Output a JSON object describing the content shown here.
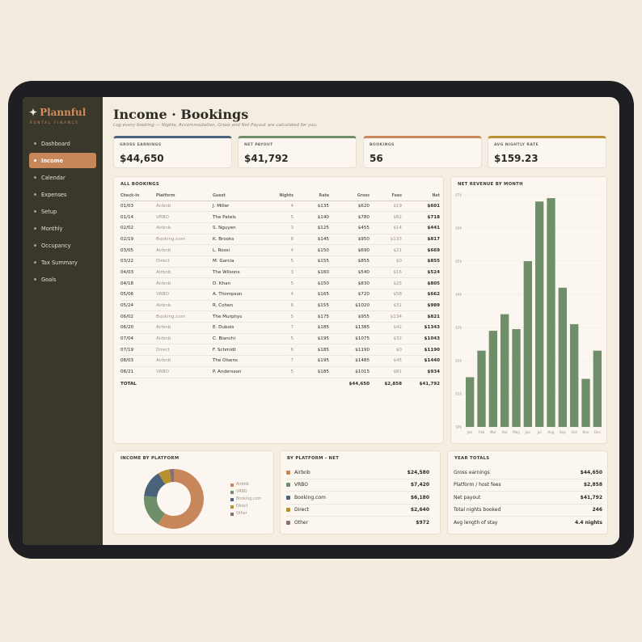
{
  "brand": {
    "name": "Plannful",
    "subtitle": "RENTAL FINANCE"
  },
  "nav": [
    {
      "label": "Dashboard",
      "active": false
    },
    {
      "label": "Income",
      "active": true
    },
    {
      "label": "Calendar",
      "active": false
    },
    {
      "label": "Expenses",
      "active": false
    },
    {
      "label": "Setup",
      "active": false
    },
    {
      "label": "Monthly",
      "active": false
    },
    {
      "label": "Occupancy",
      "active": false
    },
    {
      "label": "Tax Summary",
      "active": false
    },
    {
      "label": "Goals",
      "active": false
    }
  ],
  "page": {
    "title": "Income · Bookings",
    "subtitle": "Log every booking — Nights, Accommodation, Gross and Net Payout are calculated for you."
  },
  "kpis": [
    {
      "label": "GROSS EARNINGS",
      "value": "$44,650",
      "color": "#4a637a"
    },
    {
      "label": "NET PAYOUT",
      "value": "$41,792",
      "color": "#6f8f6a"
    },
    {
      "label": "BOOKINGS",
      "value": "56",
      "color": "#c8875a"
    },
    {
      "label": "AVG NIGHTLY RATE",
      "value": "$159.23",
      "color": "#b8902f"
    }
  ],
  "bookings": {
    "title": "ALL BOOKINGS",
    "columns": [
      "Check-in",
      "Platform",
      "Guest",
      "Nights",
      "Rate",
      "Gross",
      "Fees",
      "Net"
    ],
    "rows": [
      [
        "01/03",
        "Airbnb",
        "J. Miller",
        "4",
        "$135",
        "$620",
        "$19",
        "$601"
      ],
      [
        "01/14",
        "VRBO",
        "The Patels",
        "5",
        "$140",
        "$780",
        "$62",
        "$718"
      ],
      [
        "02/02",
        "Airbnb",
        "S. Nguyen",
        "3",
        "$125",
        "$455",
        "$14",
        "$441"
      ],
      [
        "02/19",
        "Booking.com",
        "K. Brooks",
        "6",
        "$145",
        "$950",
        "$133",
        "$817"
      ],
      [
        "03/05",
        "Airbnb",
        "L. Rossi",
        "4",
        "$150",
        "$690",
        "$21",
        "$669"
      ],
      [
        "03/22",
        "Direct",
        "M. Garcia",
        "5",
        "$155",
        "$855",
        "$0",
        "$855"
      ],
      [
        "04/03",
        "Airbnb",
        "The Wilsons",
        "3",
        "$160",
        "$540",
        "$16",
        "$524"
      ],
      [
        "04/18",
        "Airbnb",
        "D. Khan",
        "5",
        "$150",
        "$830",
        "$25",
        "$805"
      ],
      [
        "05/06",
        "VRBO",
        "A. Thompson",
        "4",
        "$165",
        "$720",
        "$58",
        "$662"
      ],
      [
        "05/24",
        "Airbnb",
        "R. Cohen",
        "6",
        "$155",
        "$1020",
        "$31",
        "$989"
      ],
      [
        "06/02",
        "Booking.com",
        "The Murphys",
        "5",
        "$175",
        "$955",
        "$134",
        "$821"
      ],
      [
        "06/20",
        "Airbnb",
        "E. Dubois",
        "7",
        "$185",
        "$1385",
        "$42",
        "$1343"
      ],
      [
        "07/04",
        "Airbnb",
        "C. Bianchi",
        "5",
        "$195",
        "$1075",
        "$32",
        "$1043"
      ],
      [
        "07/19",
        "Direct",
        "F. Schmidt",
        "6",
        "$185",
        "$1190",
        "$0",
        "$1190"
      ],
      [
        "08/03",
        "Airbnb",
        "The Olsens",
        "7",
        "$195",
        "$1485",
        "$45",
        "$1440"
      ],
      [
        "08/21",
        "VRBO",
        "P. Andersson",
        "5",
        "$185",
        "$1015",
        "$81",
        "$934"
      ]
    ],
    "total": {
      "label": "TOTAL",
      "gross": "$44,650",
      "fees": "$2,858",
      "net": "$41,792"
    }
  },
  "chart_data": {
    "type": "bar",
    "title": "NET REVENUE BY MONTH",
    "categories": [
      "Jan",
      "Feb",
      "Mar",
      "Apr",
      "May",
      "Jun",
      "Jul",
      "Aug",
      "Sep",
      "Oct",
      "Nov",
      "Dec"
    ],
    "values": [
      1500,
      2300,
      2900,
      3400,
      2950,
      5000,
      6800,
      6900,
      4200,
      3100,
      1450,
      2300
    ],
    "ylim": [
      0,
      7000
    ],
    "yticks": [
      "$0k",
      "$1k",
      "$2k",
      "$3k",
      "$4k",
      "$5k",
      "$6k",
      "$7k"
    ],
    "color": "#6f8f6a",
    "grid": true
  },
  "platform_donut": {
    "title": "INCOME BY PLATFORM",
    "legend": [
      "Airbnb",
      "VRBO",
      "Booking.com",
      "Direct",
      "Other"
    ],
    "colors": [
      "#c8875a",
      "#6f8f6a",
      "#4a637a",
      "#b8902f",
      "#8a6f6f"
    ],
    "values": [
      24580,
      7420,
      6180,
      2640,
      972
    ]
  },
  "by_platform": {
    "title": "BY PLATFORM - NET",
    "rows": [
      {
        "name": "Airbnb",
        "value": "$24,580"
      },
      {
        "name": "VRBO",
        "value": "$7,420"
      },
      {
        "name": "Booking.com",
        "value": "$6,180"
      },
      {
        "name": "Direct",
        "value": "$2,640"
      },
      {
        "name": "Other",
        "value": "$972"
      }
    ]
  },
  "year_totals": {
    "title": "YEAR TOTALS",
    "rows": [
      {
        "label": "Gross earnings",
        "value": "$44,650"
      },
      {
        "label": "Platform / host fees",
        "value": "$2,858"
      },
      {
        "label": "Net payout",
        "value": "$41,792"
      },
      {
        "label": "Total nights booked",
        "value": "246"
      },
      {
        "label": "Avg length of stay",
        "value": "4.4 nights"
      }
    ]
  }
}
